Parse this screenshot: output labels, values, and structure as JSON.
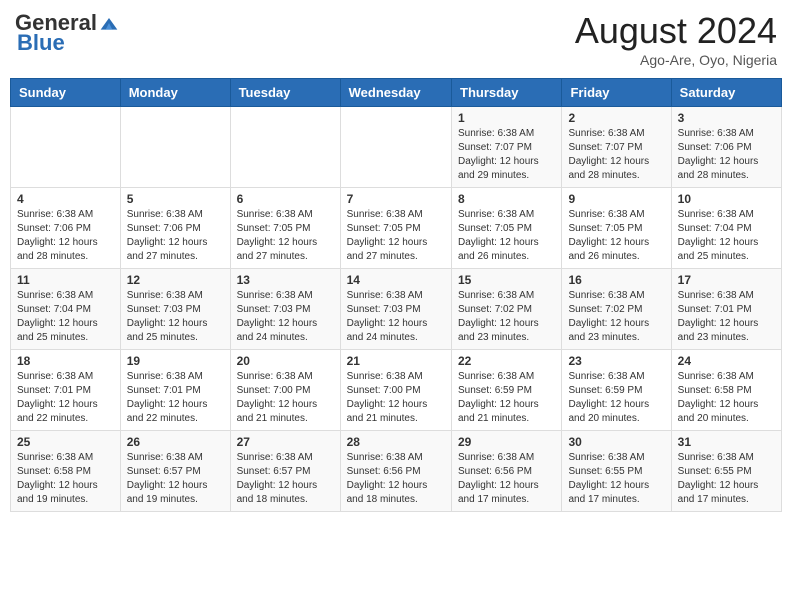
{
  "header": {
    "logo_general": "General",
    "logo_blue": "Blue",
    "month_year": "August 2024",
    "location": "Ago-Are, Oyo, Nigeria"
  },
  "days_of_week": [
    "Sunday",
    "Monday",
    "Tuesday",
    "Wednesday",
    "Thursday",
    "Friday",
    "Saturday"
  ],
  "weeks": [
    [
      {
        "day": "",
        "info": ""
      },
      {
        "day": "",
        "info": ""
      },
      {
        "day": "",
        "info": ""
      },
      {
        "day": "",
        "info": ""
      },
      {
        "day": "1",
        "info": "Sunrise: 6:38 AM\nSunset: 7:07 PM\nDaylight: 12 hours\nand 29 minutes."
      },
      {
        "day": "2",
        "info": "Sunrise: 6:38 AM\nSunset: 7:07 PM\nDaylight: 12 hours\nand 28 minutes."
      },
      {
        "day": "3",
        "info": "Sunrise: 6:38 AM\nSunset: 7:06 PM\nDaylight: 12 hours\nand 28 minutes."
      }
    ],
    [
      {
        "day": "4",
        "info": "Sunrise: 6:38 AM\nSunset: 7:06 PM\nDaylight: 12 hours\nand 28 minutes."
      },
      {
        "day": "5",
        "info": "Sunrise: 6:38 AM\nSunset: 7:06 PM\nDaylight: 12 hours\nand 27 minutes."
      },
      {
        "day": "6",
        "info": "Sunrise: 6:38 AM\nSunset: 7:05 PM\nDaylight: 12 hours\nand 27 minutes."
      },
      {
        "day": "7",
        "info": "Sunrise: 6:38 AM\nSunset: 7:05 PM\nDaylight: 12 hours\nand 27 minutes."
      },
      {
        "day": "8",
        "info": "Sunrise: 6:38 AM\nSunset: 7:05 PM\nDaylight: 12 hours\nand 26 minutes."
      },
      {
        "day": "9",
        "info": "Sunrise: 6:38 AM\nSunset: 7:05 PM\nDaylight: 12 hours\nand 26 minutes."
      },
      {
        "day": "10",
        "info": "Sunrise: 6:38 AM\nSunset: 7:04 PM\nDaylight: 12 hours\nand 25 minutes."
      }
    ],
    [
      {
        "day": "11",
        "info": "Sunrise: 6:38 AM\nSunset: 7:04 PM\nDaylight: 12 hours\nand 25 minutes."
      },
      {
        "day": "12",
        "info": "Sunrise: 6:38 AM\nSunset: 7:03 PM\nDaylight: 12 hours\nand 25 minutes."
      },
      {
        "day": "13",
        "info": "Sunrise: 6:38 AM\nSunset: 7:03 PM\nDaylight: 12 hours\nand 24 minutes."
      },
      {
        "day": "14",
        "info": "Sunrise: 6:38 AM\nSunset: 7:03 PM\nDaylight: 12 hours\nand 24 minutes."
      },
      {
        "day": "15",
        "info": "Sunrise: 6:38 AM\nSunset: 7:02 PM\nDaylight: 12 hours\nand 23 minutes."
      },
      {
        "day": "16",
        "info": "Sunrise: 6:38 AM\nSunset: 7:02 PM\nDaylight: 12 hours\nand 23 minutes."
      },
      {
        "day": "17",
        "info": "Sunrise: 6:38 AM\nSunset: 7:01 PM\nDaylight: 12 hours\nand 23 minutes."
      }
    ],
    [
      {
        "day": "18",
        "info": "Sunrise: 6:38 AM\nSunset: 7:01 PM\nDaylight: 12 hours\nand 22 minutes."
      },
      {
        "day": "19",
        "info": "Sunrise: 6:38 AM\nSunset: 7:01 PM\nDaylight: 12 hours\nand 22 minutes."
      },
      {
        "day": "20",
        "info": "Sunrise: 6:38 AM\nSunset: 7:00 PM\nDaylight: 12 hours\nand 21 minutes."
      },
      {
        "day": "21",
        "info": "Sunrise: 6:38 AM\nSunset: 7:00 PM\nDaylight: 12 hours\nand 21 minutes."
      },
      {
        "day": "22",
        "info": "Sunrise: 6:38 AM\nSunset: 6:59 PM\nDaylight: 12 hours\nand 21 minutes."
      },
      {
        "day": "23",
        "info": "Sunrise: 6:38 AM\nSunset: 6:59 PM\nDaylight: 12 hours\nand 20 minutes."
      },
      {
        "day": "24",
        "info": "Sunrise: 6:38 AM\nSunset: 6:58 PM\nDaylight: 12 hours\nand 20 minutes."
      }
    ],
    [
      {
        "day": "25",
        "info": "Sunrise: 6:38 AM\nSunset: 6:58 PM\nDaylight: 12 hours\nand 19 minutes."
      },
      {
        "day": "26",
        "info": "Sunrise: 6:38 AM\nSunset: 6:57 PM\nDaylight: 12 hours\nand 19 minutes."
      },
      {
        "day": "27",
        "info": "Sunrise: 6:38 AM\nSunset: 6:57 PM\nDaylight: 12 hours\nand 18 minutes."
      },
      {
        "day": "28",
        "info": "Sunrise: 6:38 AM\nSunset: 6:56 PM\nDaylight: 12 hours\nand 18 minutes."
      },
      {
        "day": "29",
        "info": "Sunrise: 6:38 AM\nSunset: 6:56 PM\nDaylight: 12 hours\nand 17 minutes."
      },
      {
        "day": "30",
        "info": "Sunrise: 6:38 AM\nSunset: 6:55 PM\nDaylight: 12 hours\nand 17 minutes."
      },
      {
        "day": "31",
        "info": "Sunrise: 6:38 AM\nSunset: 6:55 PM\nDaylight: 12 hours\nand 17 minutes."
      }
    ]
  ]
}
